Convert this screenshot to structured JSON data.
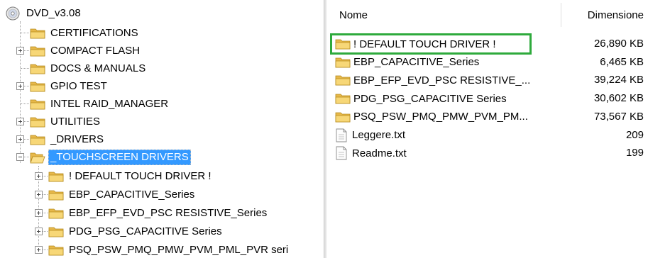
{
  "tree": {
    "root": "DVD_v3.08",
    "items": [
      {
        "label": "CERTIFICATIONS",
        "expander": "none"
      },
      {
        "label": "COMPACT FLASH",
        "expander": "plus"
      },
      {
        "label": "DOCS & MANUALS",
        "expander": "none"
      },
      {
        "label": "GPIO TEST",
        "expander": "plus"
      },
      {
        "label": "INTEL RAID_MANAGER",
        "expander": "none"
      },
      {
        "label": "UTILITIES",
        "expander": "plus"
      },
      {
        "label": "_DRIVERS",
        "expander": "plus"
      },
      {
        "label": "_TOUCHSCREEN DRIVERS",
        "expander": "minus",
        "selected": true
      }
    ],
    "subitems": [
      "! DEFAULT TOUCH DRIVER !",
      "EBP_CAPACITIVE_Series",
      "EBP_EFP_EVD_PSC RESISTIVE_Series",
      "PDG_PSG_CAPACITIVE Series",
      "PSQ_PSW_PMQ_PMW_PVM_PML_PVR seri"
    ]
  },
  "list": {
    "columns": {
      "name": "Nome",
      "size": "Dimensione"
    },
    "rows": [
      {
        "name": "! DEFAULT TOUCH DRIVER !",
        "size": "26,890 KB",
        "type": "folder",
        "highlighted": true
      },
      {
        "name": "EBP_CAPACITIVE_Series",
        "size": "6,465 KB",
        "type": "folder"
      },
      {
        "name": "EBP_EFP_EVD_PSC RESISTIVE_...",
        "size": "39,224 KB",
        "type": "folder"
      },
      {
        "name": "PDG_PSG_CAPACITIVE Series",
        "size": "30,602 KB",
        "type": "folder"
      },
      {
        "name": "PSQ_PSW_PMQ_PMW_PVM_PM...",
        "size": "73,567 KB",
        "type": "folder"
      },
      {
        "name": "Leggere.txt",
        "size": "209",
        "type": "file"
      },
      {
        "name": "Readme.txt",
        "size": "199",
        "type": "file"
      }
    ]
  },
  "icons": {
    "folder": "folder-icon",
    "open_folder": "open-folder-icon",
    "disc": "dvd-disc-icon",
    "file": "text-file-icon"
  },
  "colors": {
    "selection": "#3399ff",
    "highlight_border": "#2eaa3c",
    "folder": "#f3cf6b"
  }
}
